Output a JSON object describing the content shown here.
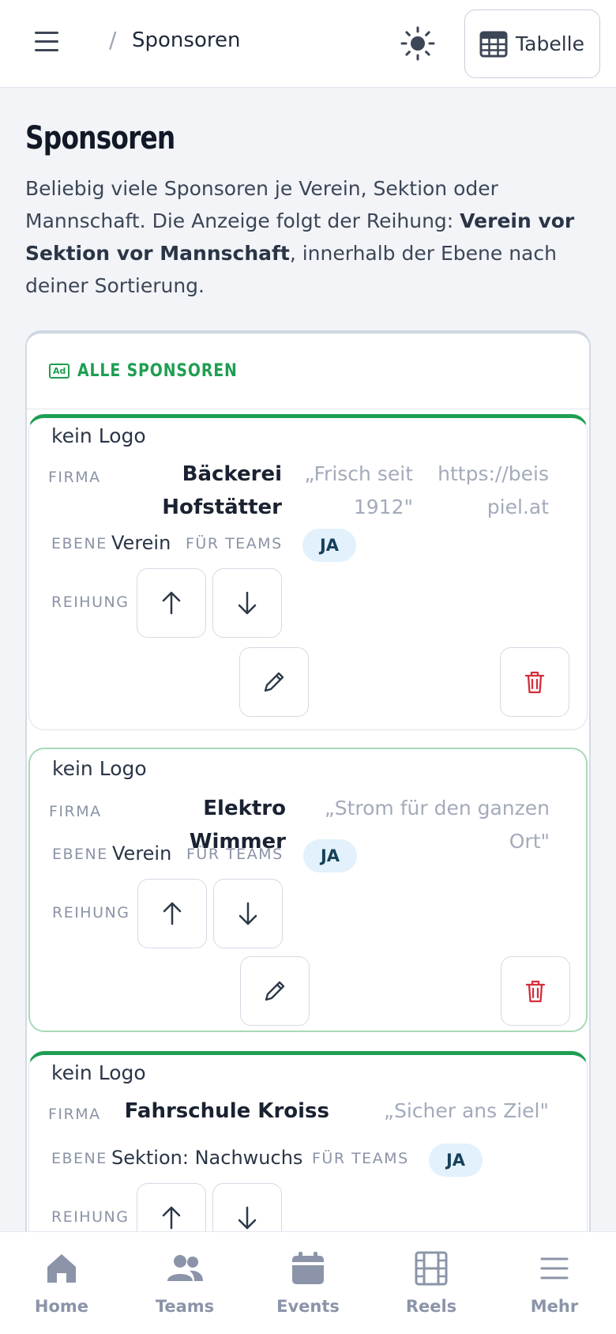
{
  "header": {
    "breadcrumb_sep": "/",
    "title": "Sponsoren",
    "table_button_label": "Tabelle"
  },
  "intro": {
    "heading": "Sponsoren",
    "text_1": "Beliebig viele Sponsoren je Verein, Sektion oder Mannschaft. Die Anzeige folgt der Reihung: ",
    "text_bold": "Verein vor Sektion vor Mannschaft",
    "text_2": ", innerhalb der Ebene nach deiner Sortierung."
  },
  "panel": {
    "badge": "Ad",
    "title": "ALLE SPONSOREN"
  },
  "labels": {
    "no_logo": "kein Logo",
    "firma": "FIRMA",
    "ebene": "EBENE",
    "fuer_teams": "FÜR TEAMS",
    "reihung": "REIHUNG"
  },
  "sponsors": [
    {
      "firma": "Bäckerei Hofstätter",
      "slogan": "„Frisch seit 1912\"",
      "url": "https://beispiel.at",
      "ebene": "Verein",
      "fuer_teams": "JA"
    },
    {
      "firma": "Elektro Wimmer",
      "slogan": "„Strom für den ganzen Ort\"",
      "url": "",
      "ebene": "Verein",
      "fuer_teams": "JA"
    },
    {
      "firma": "Fahrschule Kroiss",
      "slogan": "„Sicher ans Ziel\"",
      "url": "",
      "ebene": "Sektion: Nachwuchs",
      "fuer_teams": "JA"
    }
  ],
  "nav": [
    {
      "label": "Home",
      "icon": "home-icon"
    },
    {
      "label": "Teams",
      "icon": "users-icon"
    },
    {
      "label": "Events",
      "icon": "calendar-icon"
    },
    {
      "label": "Reels",
      "icon": "film-icon"
    },
    {
      "label": "Mehr",
      "icon": "menu-icon"
    }
  ],
  "colors": {
    "accent_green": "#1e9e52",
    "delete_red": "#d32f3a",
    "pill_bg": "#e2f1fb"
  }
}
